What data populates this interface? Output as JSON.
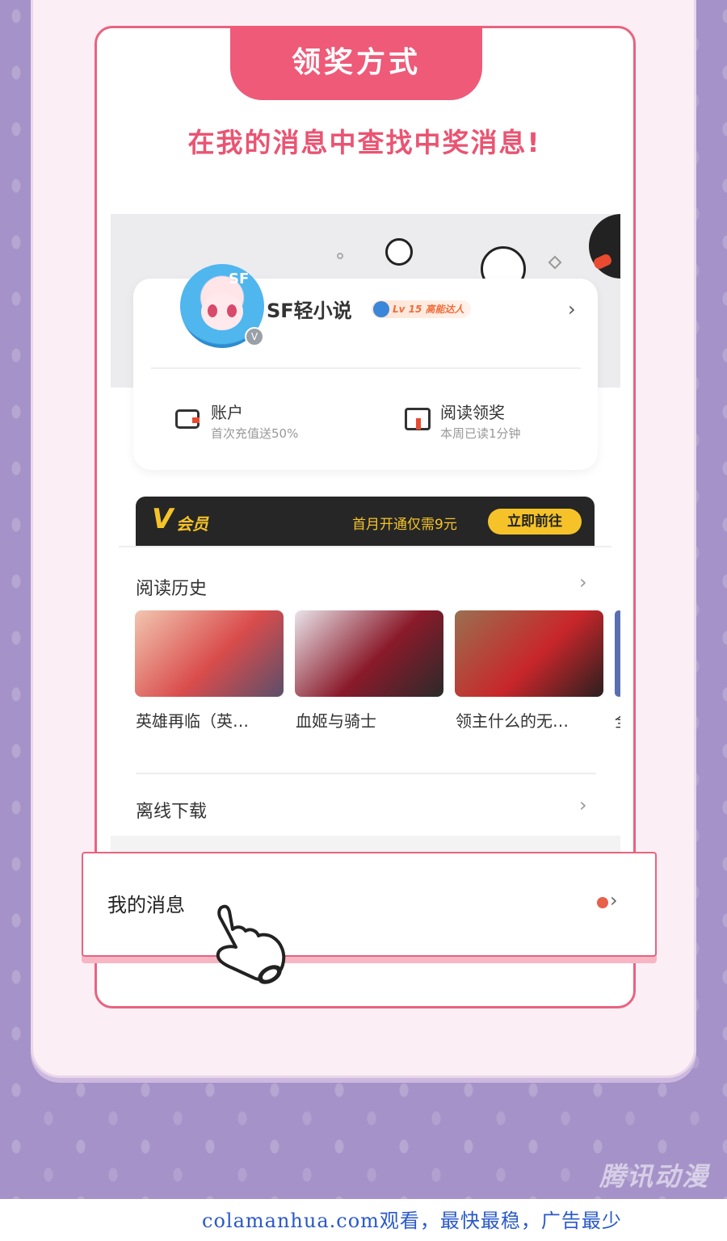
{
  "header": {
    "title": "领奖方式",
    "headline": "在我的消息中查找中奖消息!"
  },
  "profile": {
    "username": "SF轻小说",
    "level_badge": "Lv 15 高能达人",
    "avatar_badge": "V"
  },
  "quick_actions": [
    {
      "title": "账户",
      "subtitle": "首次充值送50%",
      "icon": "wallet-icon"
    },
    {
      "title": "阅读领奖",
      "subtitle": "本周已读1分钟",
      "icon": "gift-icon"
    }
  ],
  "vip": {
    "v": "V",
    "label": "会员",
    "offer": "首月开通仅需9元",
    "button": "立即前往"
  },
  "history": {
    "title": "阅读历史",
    "books": [
      {
        "name": "英雄再临（英…",
        "colors": [
          "#f2c6b0",
          "#d94c4c",
          "#5a4f6a"
        ]
      },
      {
        "name": "血姬与骑士",
        "colors": [
          "#e9e4ea",
          "#8a1a2a",
          "#2a2a2a"
        ]
      },
      {
        "name": "领主什么的无…",
        "colors": [
          "#9a7050",
          "#c8262a",
          "#2a1f1f"
        ]
      }
    ],
    "partial_book_char": "全"
  },
  "offline": {
    "title": "离线下载"
  },
  "messages": {
    "label": "我的消息"
  },
  "colors": {
    "accent": "#ee5a78",
    "vip_gold": "#f5c329",
    "background": "#a592c8"
  },
  "watermark": "腾讯动漫",
  "footer": "colamanhua.com观看，最快最稳，广告最少"
}
